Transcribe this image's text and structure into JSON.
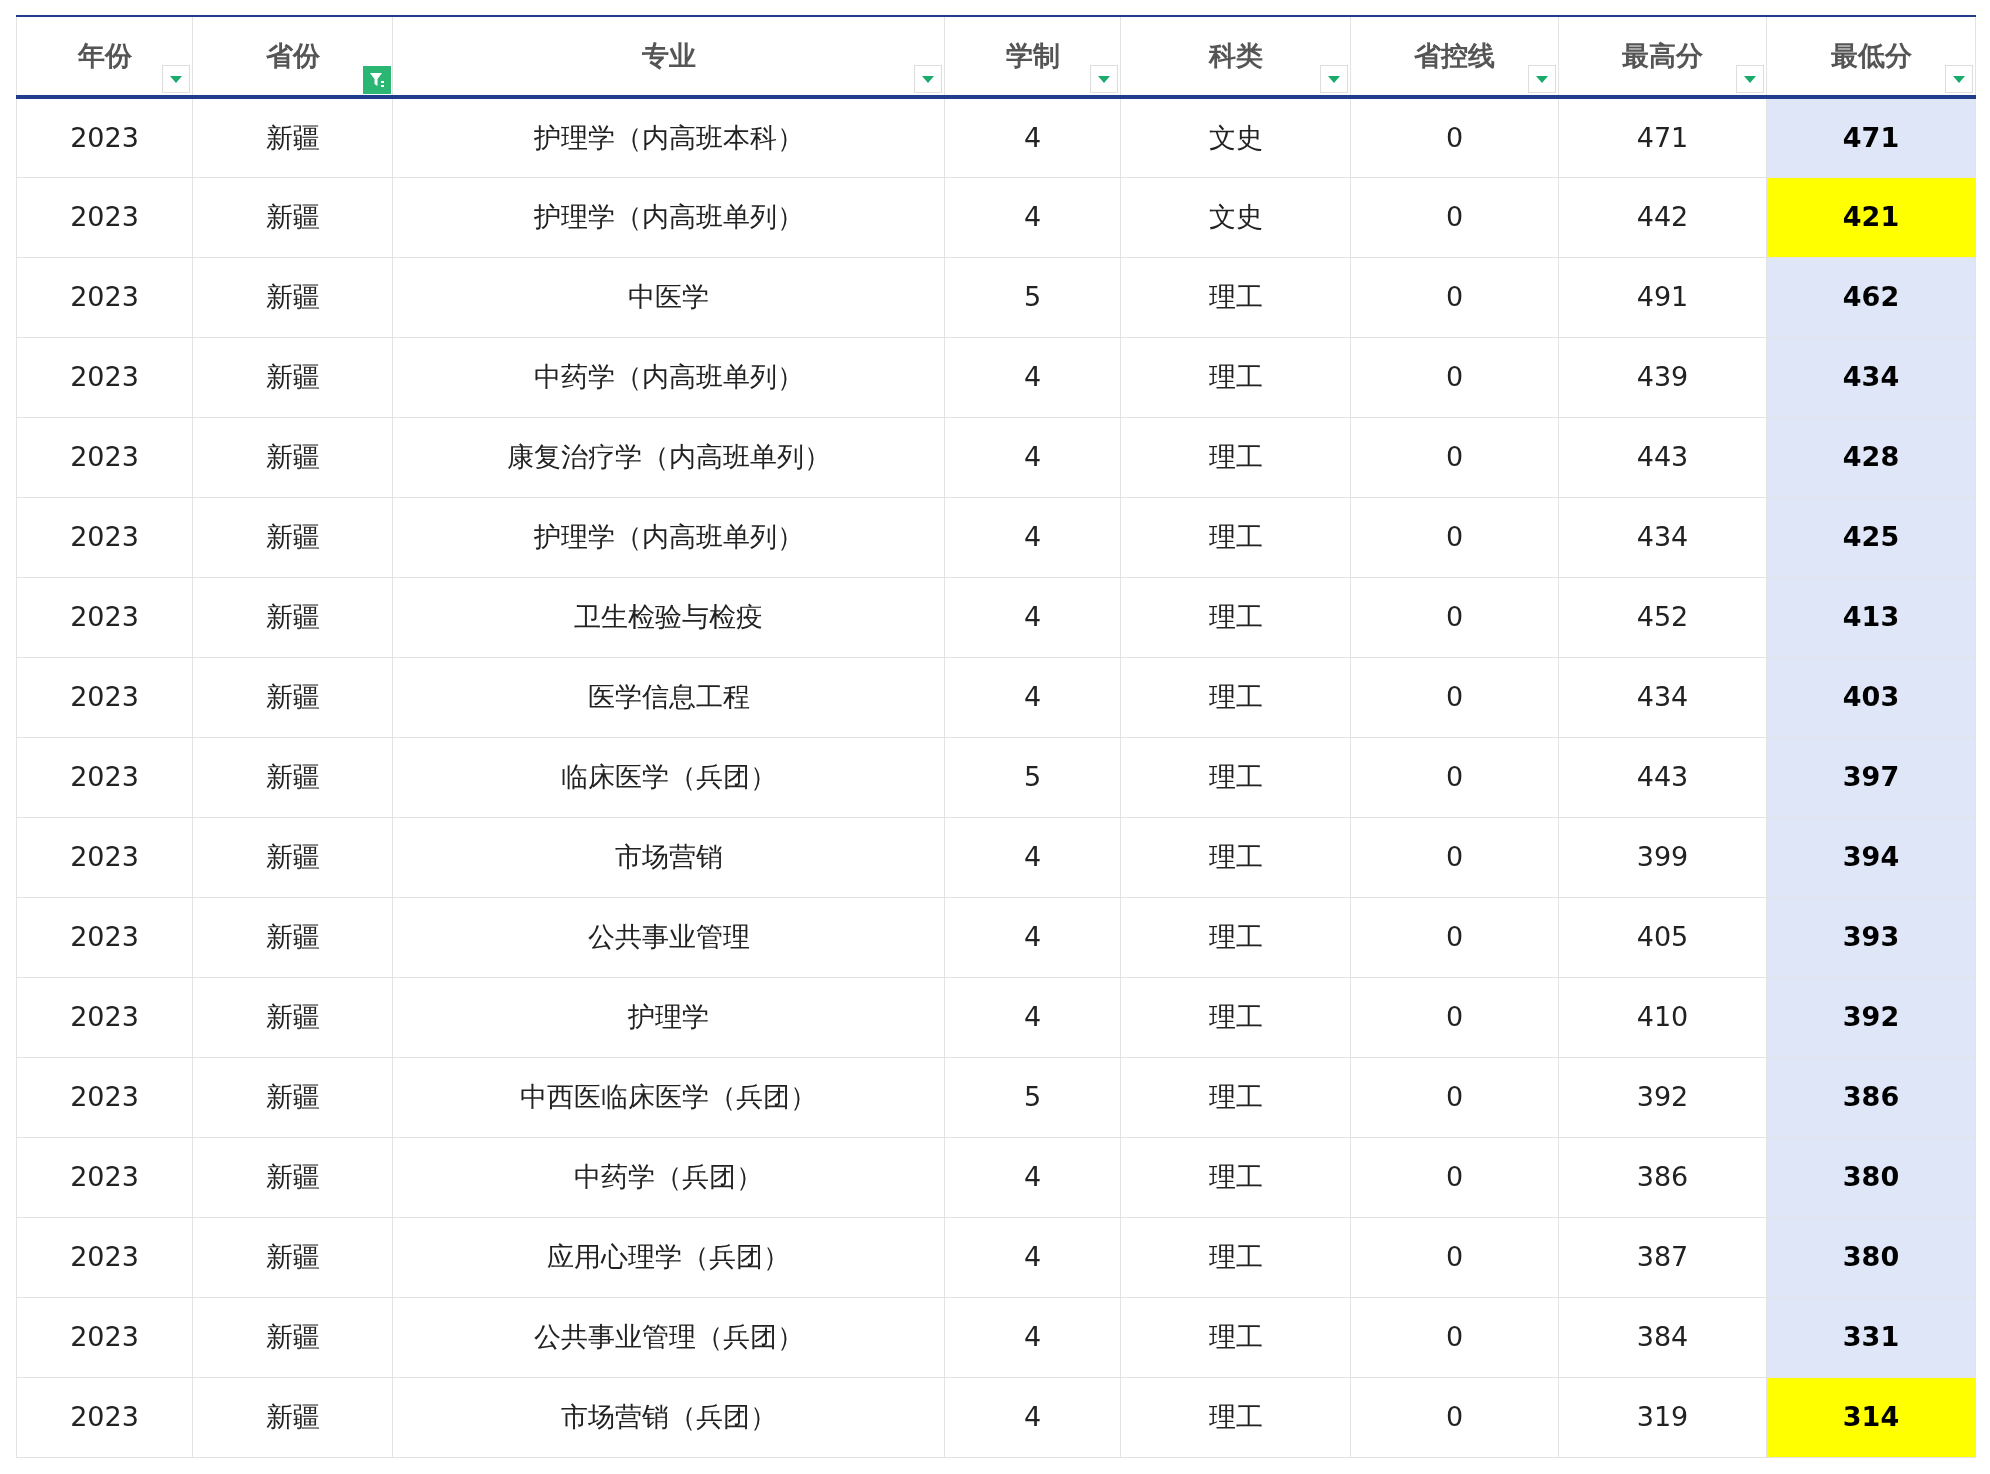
{
  "columns": [
    {
      "label": "年份",
      "filtered": false
    },
    {
      "label": "省份",
      "filtered": true
    },
    {
      "label": "专业",
      "filtered": false
    },
    {
      "label": "学制",
      "filtered": false
    },
    {
      "label": "科类",
      "filtered": false
    },
    {
      "label": "省控线",
      "filtered": false
    },
    {
      "label": "最高分",
      "filtered": false
    },
    {
      "label": "最低分",
      "filtered": false
    }
  ],
  "rows": [
    {
      "cells": [
        "2023",
        "新疆",
        "护理学（内高班本科）",
        "4",
        "文史",
        "0",
        "471",
        "471"
      ],
      "highlighted": false
    },
    {
      "cells": [
        "2023",
        "新疆",
        "护理学（内高班单列）",
        "4",
        "文史",
        "0",
        "442",
        "421"
      ],
      "highlighted": true
    },
    {
      "cells": [
        "2023",
        "新疆",
        "中医学",
        "5",
        "理工",
        "0",
        "491",
        "462"
      ],
      "highlighted": false
    },
    {
      "cells": [
        "2023",
        "新疆",
        "中药学（内高班单列）",
        "4",
        "理工",
        "0",
        "439",
        "434"
      ],
      "highlighted": false
    },
    {
      "cells": [
        "2023",
        "新疆",
        "康复治疗学（内高班单列）",
        "4",
        "理工",
        "0",
        "443",
        "428"
      ],
      "highlighted": false
    },
    {
      "cells": [
        "2023",
        "新疆",
        "护理学（内高班单列）",
        "4",
        "理工",
        "0",
        "434",
        "425"
      ],
      "highlighted": false
    },
    {
      "cells": [
        "2023",
        "新疆",
        "卫生检验与检疫",
        "4",
        "理工",
        "0",
        "452",
        "413"
      ],
      "highlighted": false
    },
    {
      "cells": [
        "2023",
        "新疆",
        "医学信息工程",
        "4",
        "理工",
        "0",
        "434",
        "403"
      ],
      "highlighted": false
    },
    {
      "cells": [
        "2023",
        "新疆",
        "临床医学（兵团）",
        "5",
        "理工",
        "0",
        "443",
        "397"
      ],
      "highlighted": false
    },
    {
      "cells": [
        "2023",
        "新疆",
        "市场营销",
        "4",
        "理工",
        "0",
        "399",
        "394"
      ],
      "highlighted": false
    },
    {
      "cells": [
        "2023",
        "新疆",
        "公共事业管理",
        "4",
        "理工",
        "0",
        "405",
        "393"
      ],
      "highlighted": false
    },
    {
      "cells": [
        "2023",
        "新疆",
        "护理学",
        "4",
        "理工",
        "0",
        "410",
        "392"
      ],
      "highlighted": false
    },
    {
      "cells": [
        "2023",
        "新疆",
        "中西医临床医学（兵团）",
        "5",
        "理工",
        "0",
        "392",
        "386"
      ],
      "highlighted": false
    },
    {
      "cells": [
        "2023",
        "新疆",
        "中药学（兵团）",
        "4",
        "理工",
        "0",
        "386",
        "380"
      ],
      "highlighted": false
    },
    {
      "cells": [
        "2023",
        "新疆",
        "应用心理学（兵团）",
        "4",
        "理工",
        "0",
        "387",
        "380"
      ],
      "highlighted": false
    },
    {
      "cells": [
        "2023",
        "新疆",
        "公共事业管理（兵团）",
        "4",
        "理工",
        "0",
        "384",
        "331"
      ],
      "highlighted": false
    },
    {
      "cells": [
        "2023",
        "新疆",
        "市场营销（兵团）",
        "4",
        "理工",
        "0",
        "319",
        "314"
      ],
      "highlighted": true
    }
  ]
}
